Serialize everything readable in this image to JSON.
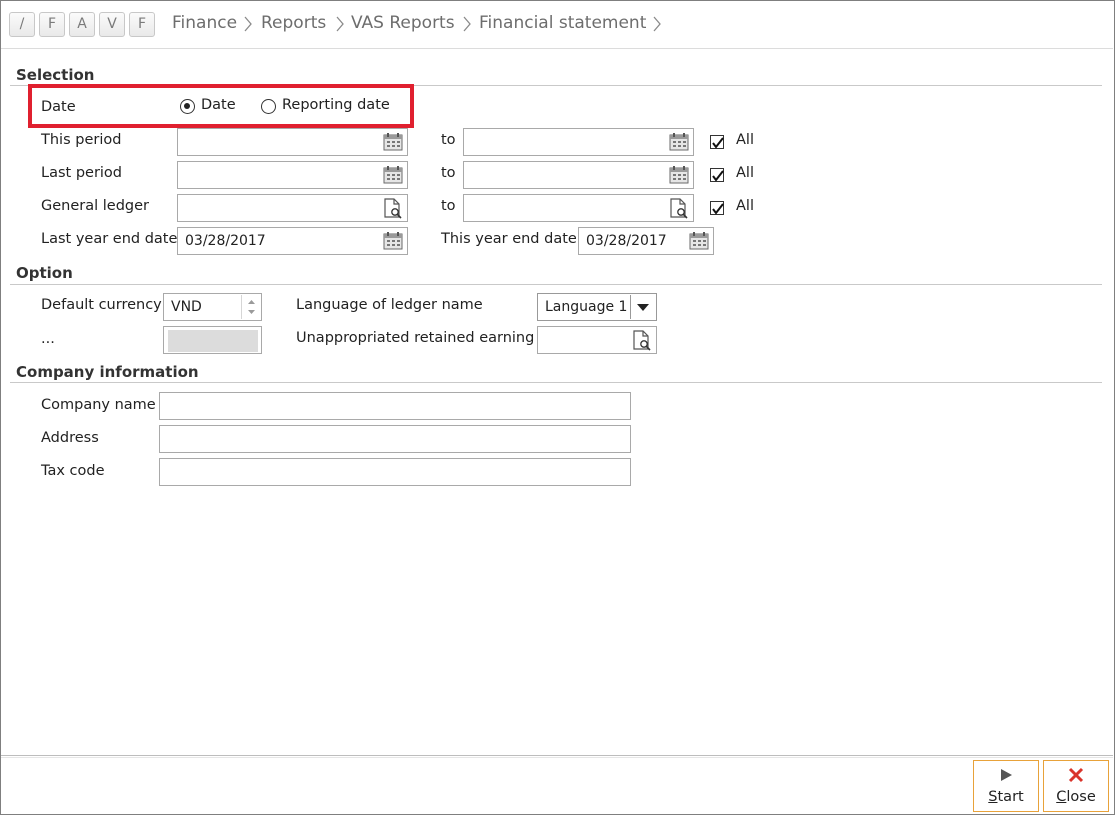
{
  "nav": {
    "buttons": [
      "/",
      "F",
      "A",
      "V",
      "F"
    ],
    "breadcrumb": [
      "Finance",
      "Reports",
      "VAS Reports",
      "Financial statement"
    ]
  },
  "selection": {
    "title": "Selection",
    "date_label": "Date",
    "radio_date": "Date",
    "radio_reporting": "Reporting date",
    "selected_radio": "Date",
    "this_period": "This period",
    "last_period": "Last period",
    "general_ledger": "General ledger",
    "to": "to",
    "all": "All",
    "last_year_end_label": "Last year end date",
    "last_year_end_value": "03/28/2017",
    "this_year_end_label": "This year end date",
    "this_year_end_value": "03/28/2017"
  },
  "option": {
    "title": "Option",
    "default_currency_label": "Default currency",
    "default_currency_value": "VND",
    "ellipsis_label": "...",
    "language_label": "Language of ledger name",
    "language_value": "Language 1",
    "unappropriated_label": "Unappropriated retained earning"
  },
  "company": {
    "title": "Company information",
    "name_label": "Company name",
    "address_label": "Address",
    "tax_label": "Tax code"
  },
  "actions": {
    "start_label": "Start",
    "start_key": "S",
    "start_rest": "tart",
    "close_label": "Close",
    "close_key": "C",
    "close_rest": "lose"
  },
  "colors": {
    "highlight": "#e0202f",
    "button_border": "#e8a23a",
    "close_icon": "#d9342b"
  }
}
